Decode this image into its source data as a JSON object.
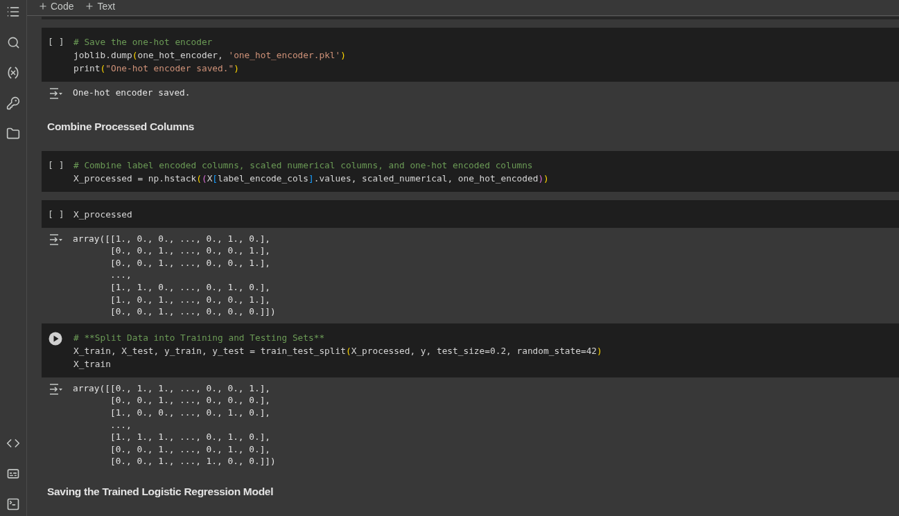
{
  "toolbar": [
    {
      "label": "Code"
    },
    {
      "label": "Text"
    }
  ],
  "cells": [
    {
      "kind": "code",
      "prompt": "[ ]",
      "lines": [
        [
          {
            "kind": "comment",
            "t": "# Save the one-hot encoder"
          }
        ],
        [
          {
            "kind": "plain",
            "t": "joblib.dump"
          },
          {
            "kind": "paren1",
            "t": "("
          },
          {
            "kind": "plain",
            "t": "one_hot_encoder, "
          },
          {
            "kind": "string",
            "t": "'one_hot_encoder.pkl'"
          },
          {
            "kind": "paren1",
            "t": ")"
          }
        ],
        [
          {
            "kind": "plain",
            "t": "print"
          },
          {
            "kind": "paren1",
            "t": "("
          },
          {
            "kind": "string",
            "t": "\"One-hot encoder saved.\""
          },
          {
            "kind": "paren1",
            "t": ")"
          }
        ]
      ],
      "output": [
        "One-hot encoder saved."
      ]
    },
    {
      "kind": "heading",
      "text": "Combine Processed Columns"
    },
    {
      "kind": "code",
      "prompt": "[ ]",
      "lines": [
        [
          {
            "kind": "comment",
            "t": "# Combine label encoded columns, scaled numerical columns, and one-hot encoded columns"
          }
        ],
        [
          {
            "kind": "plain",
            "t": "X_processed = np.hstack"
          },
          {
            "kind": "paren1",
            "t": "("
          },
          {
            "kind": "paren2",
            "t": "("
          },
          {
            "kind": "plain",
            "t": "X"
          },
          {
            "kind": "paren3",
            "t": "["
          },
          {
            "kind": "plain",
            "t": "label_encode_cols"
          },
          {
            "kind": "paren3",
            "t": "]"
          },
          {
            "kind": "plain",
            "t": ".values, scaled_numerical, one_hot_encoded"
          },
          {
            "kind": "paren2",
            "t": ")"
          },
          {
            "kind": "paren1",
            "t": ")"
          }
        ]
      ]
    },
    {
      "kind": "code",
      "prompt": "[ ]",
      "lines": [
        [
          {
            "kind": "plain",
            "t": "X_processed"
          }
        ]
      ],
      "output": [
        "array([[1., 0., 0., ..., 0., 1., 0.],",
        "       [0., 0., 1., ..., 0., 0., 1.],",
        "       [0., 0., 1., ..., 0., 0., 1.],",
        "       ...,",
        "       [1., 1., 0., ..., 0., 1., 0.],",
        "       [1., 0., 1., ..., 0., 0., 1.],",
        "       [0., 0., 1., ..., 0., 0., 0.]])"
      ]
    },
    {
      "kind": "code",
      "lines": [
        [
          {
            "kind": "comment",
            "t": "# **Split Data into Training and Testing Sets**"
          }
        ],
        [
          {
            "kind": "plain",
            "t": "X_train, X_test, y_train, y_test = train_test_split"
          },
          {
            "kind": "paren1",
            "t": "("
          },
          {
            "kind": "plain",
            "t": "X_processed, y, test_size=0.2, random_state=42"
          },
          {
            "kind": "paren1",
            "t": ")"
          }
        ],
        [
          {
            "kind": "plain",
            "t": "X_train"
          }
        ]
      ],
      "output": [
        "array([[0., 1., 1., ..., 0., 0., 1.],",
        "       [0., 0., 1., ..., 0., 0., 0.],",
        "       [1., 0., 0., ..., 0., 1., 0.],",
        "       ...,",
        "       [1., 1., 1., ..., 0., 1., 0.],",
        "       [0., 0., 1., ..., 0., 1., 0.],",
        "       [0., 0., 1., ..., 1., 0., 0.]])"
      ]
    },
    {
      "kind": "heading",
      "text": "Saving the Trained Logistic Regression Model"
    }
  ]
}
